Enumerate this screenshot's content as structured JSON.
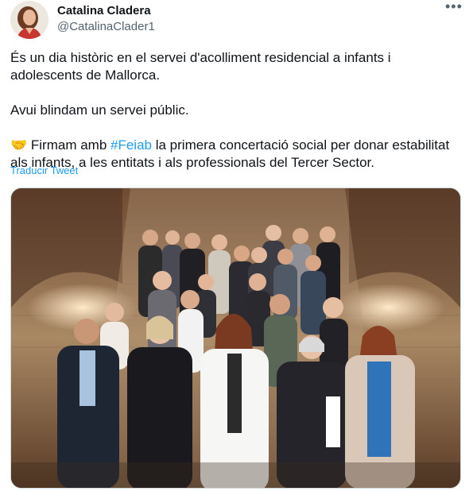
{
  "tweet": {
    "author": {
      "name": "Catalina Cladera",
      "handle": "@CatalinaClader1"
    },
    "more_label": "•••",
    "text": {
      "line1": "És un dia històric en el servei d'acolliment residencial a infants i adolescents de Mallorca.",
      "line2": "Avui blindam un servei públic.",
      "line3_emoji": "🤝",
      "line3_pre": " Firmam amb ",
      "hashtag": "#Feiab",
      "line3_post": " la primera concertació social per donar estabilitat als infants, a les entitats i als professionals del Tercer Sector."
    },
    "translate_label": "Traducir Tweet",
    "colors": {
      "link": "#1d9bf0",
      "secondary": "#536471",
      "text": "#0f1419"
    },
    "media": {
      "icon": "group-photo"
    }
  }
}
